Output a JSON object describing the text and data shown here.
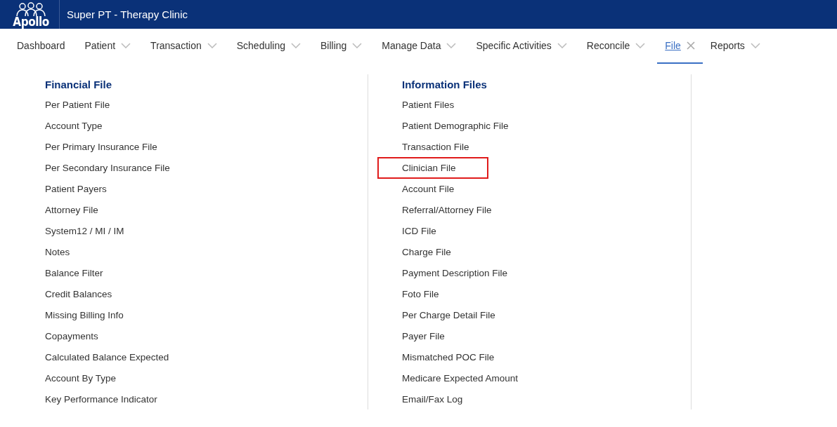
{
  "header": {
    "logo": "Apollo",
    "title": "Super PT - Therapy Clinic"
  },
  "nav": [
    {
      "label": "Dashboard",
      "kind": "link",
      "selected": false
    },
    {
      "label": "Patient",
      "kind": "menu",
      "selected": false
    },
    {
      "label": "Transaction",
      "kind": "menu",
      "selected": false
    },
    {
      "label": "Scheduling",
      "kind": "menu",
      "selected": false
    },
    {
      "label": "Billing",
      "kind": "menu",
      "selected": false
    },
    {
      "label": "Manage Data",
      "kind": "menu",
      "selected": false
    },
    {
      "label": "Specific Activities",
      "kind": "menu",
      "selected": false
    },
    {
      "label": "Reconcile",
      "kind": "menu",
      "selected": false
    },
    {
      "label": "File",
      "kind": "menu",
      "selected": true
    },
    {
      "label": "Reports",
      "kind": "menu",
      "selected": false
    }
  ],
  "columns": [
    {
      "heading": "Financial File",
      "items": [
        {
          "label": "Per Patient File",
          "highlighted": false
        },
        {
          "label": "Account Type",
          "highlighted": false
        },
        {
          "label": "Per Primary Insurance File",
          "highlighted": false
        },
        {
          "label": "Per Secondary Insurance File",
          "highlighted": false
        },
        {
          "label": "Patient Payers",
          "highlighted": false
        },
        {
          "label": "Attorney File",
          "highlighted": false
        },
        {
          "label": "System12 / MI / IM",
          "highlighted": false
        },
        {
          "label": "Notes",
          "highlighted": false
        },
        {
          "label": "Balance Filter",
          "highlighted": false
        },
        {
          "label": "Credit Balances",
          "highlighted": false
        },
        {
          "label": "Missing Billing Info",
          "highlighted": false
        },
        {
          "label": "Copayments",
          "highlighted": false
        },
        {
          "label": "Calculated Balance Expected",
          "highlighted": false
        },
        {
          "label": "Account By Type",
          "highlighted": false
        },
        {
          "label": "Key Performance Indicator",
          "highlighted": false
        }
      ]
    },
    {
      "heading": "Information Files",
      "items": [
        {
          "label": "Patient Files",
          "highlighted": false
        },
        {
          "label": "Patient Demographic File",
          "highlighted": false
        },
        {
          "label": "Transaction File",
          "highlighted": false
        },
        {
          "label": "Clinician File",
          "highlighted": true
        },
        {
          "label": "Account File",
          "highlighted": false
        },
        {
          "label": "Referral/Attorney File",
          "highlighted": false
        },
        {
          "label": "ICD File",
          "highlighted": false
        },
        {
          "label": "Charge File",
          "highlighted": false
        },
        {
          "label": "Payment Description File",
          "highlighted": false
        },
        {
          "label": "Foto File",
          "highlighted": false
        },
        {
          "label": "Per Charge Detail File",
          "highlighted": false
        },
        {
          "label": "Payer File",
          "highlighted": false
        },
        {
          "label": "Mismatched POC File",
          "highlighted": false
        },
        {
          "label": "Medicare Expected Amount",
          "highlighted": false
        },
        {
          "label": "Email/Fax Log",
          "highlighted": false
        }
      ]
    }
  ]
}
